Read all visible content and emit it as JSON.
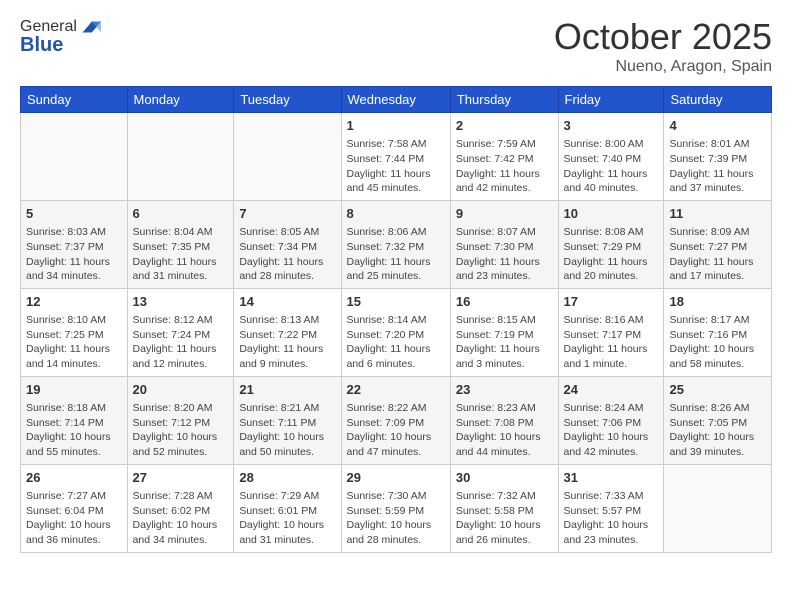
{
  "header": {
    "logo": {
      "line1": "General",
      "line2": "Blue"
    },
    "month": "October 2025",
    "location": "Nueno, Aragon, Spain"
  },
  "days_of_week": [
    "Sunday",
    "Monday",
    "Tuesday",
    "Wednesday",
    "Thursday",
    "Friday",
    "Saturday"
  ],
  "weeks": [
    [
      {
        "day": "",
        "info": ""
      },
      {
        "day": "",
        "info": ""
      },
      {
        "day": "",
        "info": ""
      },
      {
        "day": "1",
        "info": "Sunrise: 7:58 AM\nSunset: 7:44 PM\nDaylight: 11 hours and 45 minutes."
      },
      {
        "day": "2",
        "info": "Sunrise: 7:59 AM\nSunset: 7:42 PM\nDaylight: 11 hours and 42 minutes."
      },
      {
        "day": "3",
        "info": "Sunrise: 8:00 AM\nSunset: 7:40 PM\nDaylight: 11 hours and 40 minutes."
      },
      {
        "day": "4",
        "info": "Sunrise: 8:01 AM\nSunset: 7:39 PM\nDaylight: 11 hours and 37 minutes."
      }
    ],
    [
      {
        "day": "5",
        "info": "Sunrise: 8:03 AM\nSunset: 7:37 PM\nDaylight: 11 hours and 34 minutes."
      },
      {
        "day": "6",
        "info": "Sunrise: 8:04 AM\nSunset: 7:35 PM\nDaylight: 11 hours and 31 minutes."
      },
      {
        "day": "7",
        "info": "Sunrise: 8:05 AM\nSunset: 7:34 PM\nDaylight: 11 hours and 28 minutes."
      },
      {
        "day": "8",
        "info": "Sunrise: 8:06 AM\nSunset: 7:32 PM\nDaylight: 11 hours and 25 minutes."
      },
      {
        "day": "9",
        "info": "Sunrise: 8:07 AM\nSunset: 7:30 PM\nDaylight: 11 hours and 23 minutes."
      },
      {
        "day": "10",
        "info": "Sunrise: 8:08 AM\nSunset: 7:29 PM\nDaylight: 11 hours and 20 minutes."
      },
      {
        "day": "11",
        "info": "Sunrise: 8:09 AM\nSunset: 7:27 PM\nDaylight: 11 hours and 17 minutes."
      }
    ],
    [
      {
        "day": "12",
        "info": "Sunrise: 8:10 AM\nSunset: 7:25 PM\nDaylight: 11 hours and 14 minutes."
      },
      {
        "day": "13",
        "info": "Sunrise: 8:12 AM\nSunset: 7:24 PM\nDaylight: 11 hours and 12 minutes."
      },
      {
        "day": "14",
        "info": "Sunrise: 8:13 AM\nSunset: 7:22 PM\nDaylight: 11 hours and 9 minutes."
      },
      {
        "day": "15",
        "info": "Sunrise: 8:14 AM\nSunset: 7:20 PM\nDaylight: 11 hours and 6 minutes."
      },
      {
        "day": "16",
        "info": "Sunrise: 8:15 AM\nSunset: 7:19 PM\nDaylight: 11 hours and 3 minutes."
      },
      {
        "day": "17",
        "info": "Sunrise: 8:16 AM\nSunset: 7:17 PM\nDaylight: 11 hours and 1 minute."
      },
      {
        "day": "18",
        "info": "Sunrise: 8:17 AM\nSunset: 7:16 PM\nDaylight: 10 hours and 58 minutes."
      }
    ],
    [
      {
        "day": "19",
        "info": "Sunrise: 8:18 AM\nSunset: 7:14 PM\nDaylight: 10 hours and 55 minutes."
      },
      {
        "day": "20",
        "info": "Sunrise: 8:20 AM\nSunset: 7:12 PM\nDaylight: 10 hours and 52 minutes."
      },
      {
        "day": "21",
        "info": "Sunrise: 8:21 AM\nSunset: 7:11 PM\nDaylight: 10 hours and 50 minutes."
      },
      {
        "day": "22",
        "info": "Sunrise: 8:22 AM\nSunset: 7:09 PM\nDaylight: 10 hours and 47 minutes."
      },
      {
        "day": "23",
        "info": "Sunrise: 8:23 AM\nSunset: 7:08 PM\nDaylight: 10 hours and 44 minutes."
      },
      {
        "day": "24",
        "info": "Sunrise: 8:24 AM\nSunset: 7:06 PM\nDaylight: 10 hours and 42 minutes."
      },
      {
        "day": "25",
        "info": "Sunrise: 8:26 AM\nSunset: 7:05 PM\nDaylight: 10 hours and 39 minutes."
      }
    ],
    [
      {
        "day": "26",
        "info": "Sunrise: 7:27 AM\nSunset: 6:04 PM\nDaylight: 10 hours and 36 minutes."
      },
      {
        "day": "27",
        "info": "Sunrise: 7:28 AM\nSunset: 6:02 PM\nDaylight: 10 hours and 34 minutes."
      },
      {
        "day": "28",
        "info": "Sunrise: 7:29 AM\nSunset: 6:01 PM\nDaylight: 10 hours and 31 minutes."
      },
      {
        "day": "29",
        "info": "Sunrise: 7:30 AM\nSunset: 5:59 PM\nDaylight: 10 hours and 28 minutes."
      },
      {
        "day": "30",
        "info": "Sunrise: 7:32 AM\nSunset: 5:58 PM\nDaylight: 10 hours and 26 minutes."
      },
      {
        "day": "31",
        "info": "Sunrise: 7:33 AM\nSunset: 5:57 PM\nDaylight: 10 hours and 23 minutes."
      },
      {
        "day": "",
        "info": ""
      }
    ]
  ]
}
